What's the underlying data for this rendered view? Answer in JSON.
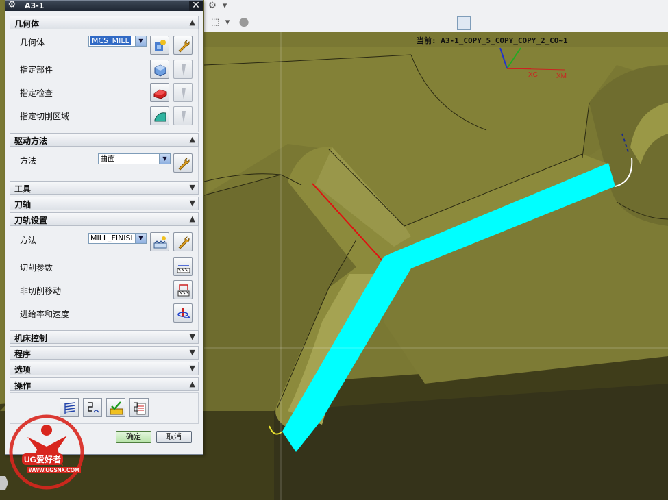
{
  "dialog": {
    "title": "A3-1",
    "sections": {
      "geometry": {
        "title": "几何体",
        "rows": {
          "geometry": {
            "label": "几何体",
            "value": "MCS_MILL"
          },
          "part": {
            "label": "指定部件"
          },
          "check": {
            "label": "指定检查"
          },
          "cut_area": {
            "label": "指定切削区域"
          }
        }
      },
      "drive": {
        "title": "驱动方法",
        "method_label": "方法",
        "method_value": "曲面"
      },
      "tool": {
        "title": "工具"
      },
      "axis": {
        "title": "刀轴"
      },
      "path": {
        "title": "刀轨设置",
        "method_label": "方法",
        "method_value": "MILL_FINISI",
        "cut_params": "切削参数",
        "non_cut": "非切削移动",
        "feeds": "进给率和速度"
      },
      "machine": {
        "title": "机床控制"
      },
      "program": {
        "title": "程序"
      },
      "options": {
        "title": "选项"
      },
      "actions": {
        "title": "操作"
      }
    },
    "ok": "确定",
    "cancel": "取消"
  },
  "viewport": {
    "current_label": "当前: A3-1_COPY_5_COPY_COPY_2_CO~1",
    "axes": {
      "xc": "XC",
      "xm": "XM"
    },
    "surface_color": "#7a7833",
    "toolpath_color": "#00ffff"
  },
  "watermark": {
    "brand": "UG爱好者",
    "url": "WWW.UGSNX.COM"
  },
  "icons": [
    "gear-icon",
    "close-icon",
    "mcs-geometry-icon",
    "wrench-icon",
    "part-icon",
    "flashlight-icon",
    "check-icon",
    "cut-area-icon",
    "mill-method-icon",
    "cut-params-icon",
    "non-cut-move-icon",
    "feeds-speeds-icon",
    "generate-icon",
    "replay-icon",
    "verify-icon",
    "list-icon"
  ]
}
